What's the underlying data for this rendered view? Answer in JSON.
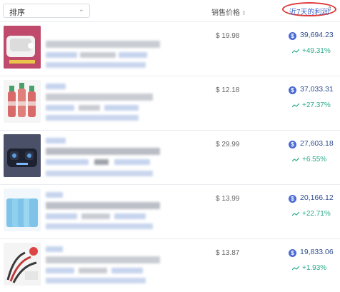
{
  "header": {
    "sort_label": "排序",
    "price_col": "销售价格",
    "profit_col": "近7天的利润"
  },
  "rows": [
    {
      "price": "$ 19.98",
      "profit": "39,694.23",
      "growth": "+49.31%"
    },
    {
      "price": "$ 12.18",
      "profit": "37,033.31",
      "growth": "+27.37%"
    },
    {
      "price": "$ 29.99",
      "profit": "27,603.18",
      "growth": "+6.55%"
    },
    {
      "price": "$ 13.99",
      "profit": "20,166.12",
      "growth": "+22.71%"
    },
    {
      "price": "$ 13.87",
      "profit": "19,833.06",
      "growth": "+1.93%"
    }
  ],
  "colors": {
    "accent": "#3c63c8",
    "growth": "#2aaa8a",
    "highlight": "#e03a3a"
  },
  "icons": [
    "chevron-down-icon",
    "sort-arrows-icon",
    "dollar-coin-icon",
    "trend-up-icon"
  ]
}
